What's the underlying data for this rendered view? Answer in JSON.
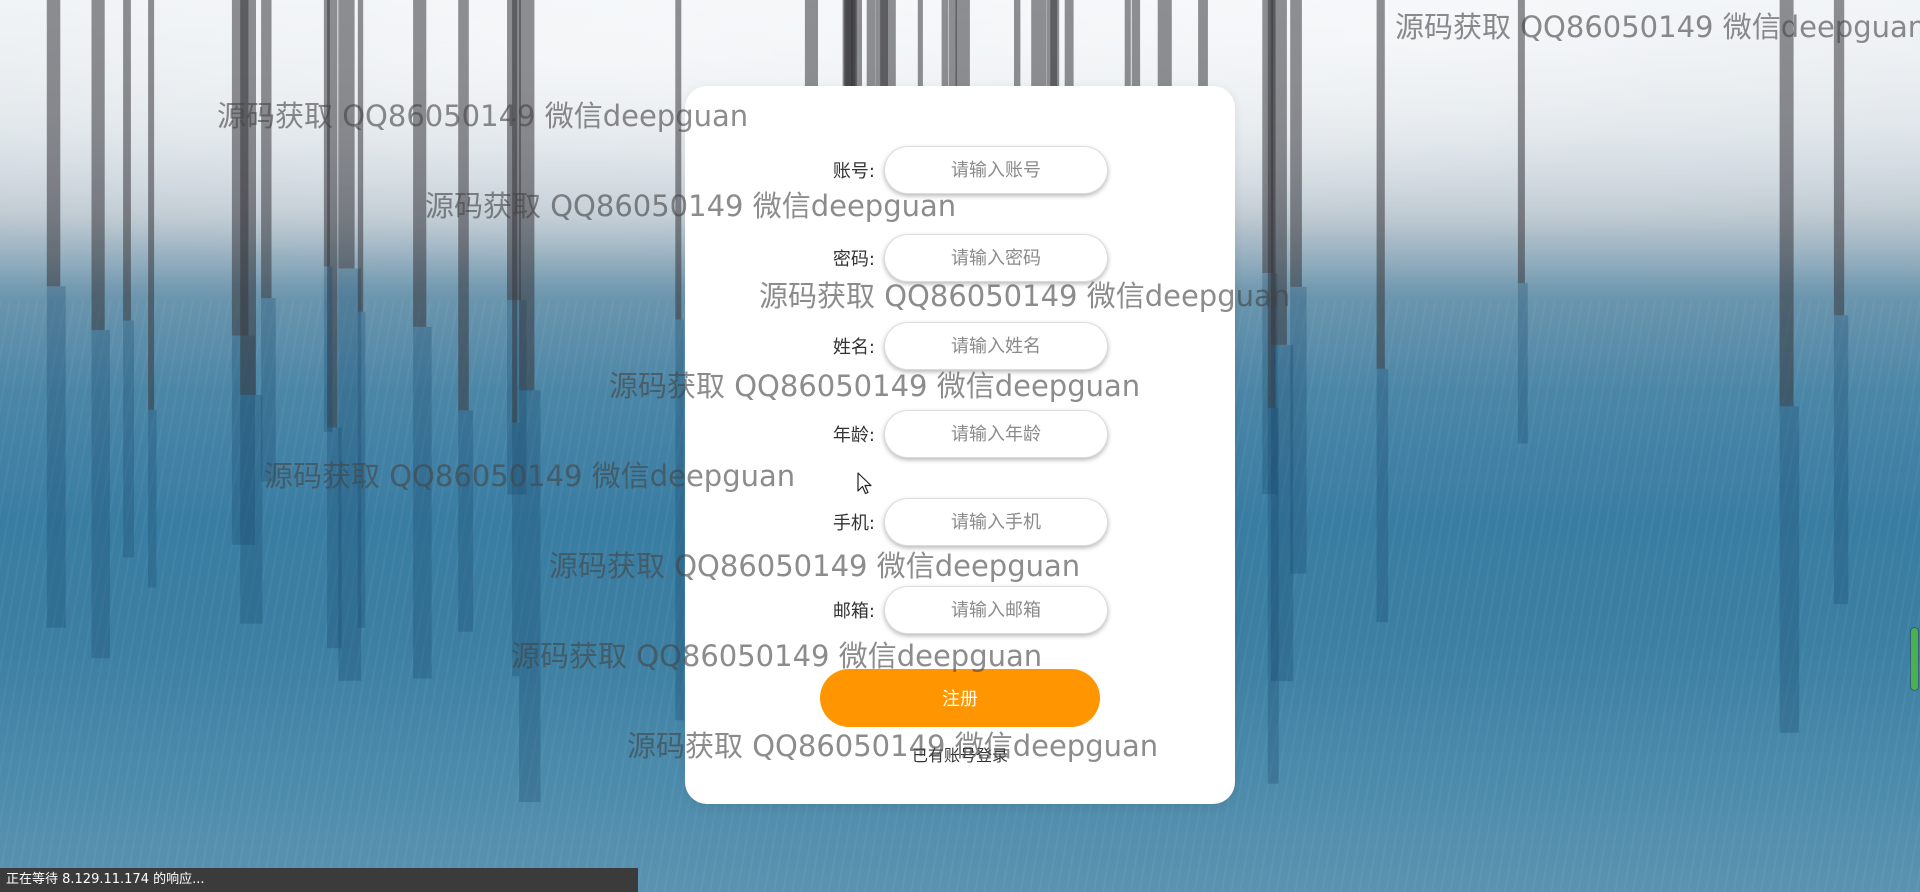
{
  "form": {
    "fields": [
      {
        "label": "账号:",
        "placeholder": "请输入账号"
      },
      {
        "label": "密码:",
        "placeholder": "请输入密码"
      },
      {
        "label": "姓名:",
        "placeholder": "请输入姓名"
      },
      {
        "label": "年龄:",
        "placeholder": "请输入年龄"
      },
      {
        "label": "手机:",
        "placeholder": "请输入手机"
      },
      {
        "label": "邮箱:",
        "placeholder": "请输入邮箱"
      }
    ],
    "register_label": "注册",
    "login_link": "已有账号登录"
  },
  "watermark": {
    "text": "源码获取 QQ86050149 微信deepguan"
  },
  "status_bar": {
    "text": "正在等待 8.129.11.174 的响应..."
  },
  "colors": {
    "accent": "#ff9500",
    "card": "#ffffff"
  },
  "icons": {
    "cursor": "mouse-pointer-icon"
  }
}
